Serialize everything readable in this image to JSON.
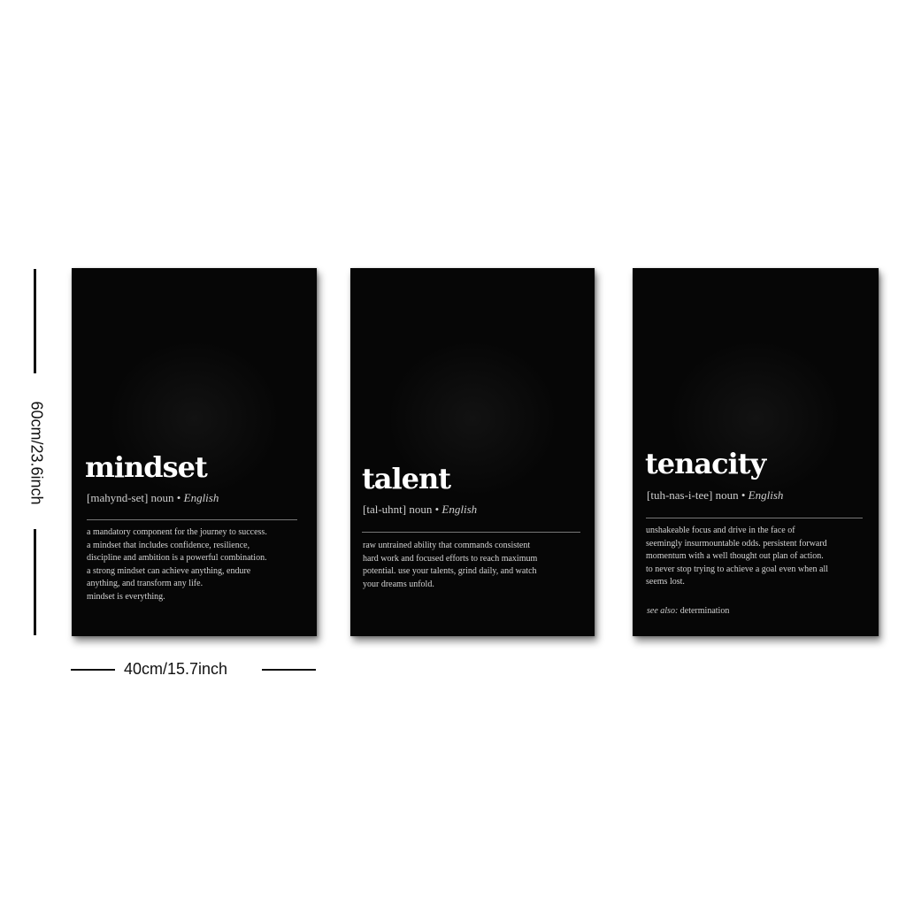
{
  "dimensions": {
    "height_label": "60cm/23.6inch",
    "width_label": "40cm/15.7inch"
  },
  "panels": [
    {
      "word": "mindset",
      "pronunciation": "[mahynd-set] noun •",
      "language": "English",
      "definition_lines": [
        "a mandatory component for the journey to success.",
        "a mindset that includes confidence, resilience,",
        "discipline and ambition is a powerful combination.",
        "a strong mindset can achieve anything, endure",
        "anything, and transform any life.",
        "mindset is everything."
      ]
    },
    {
      "word": "talent",
      "pronunciation": "[tal-uhnt] noun •",
      "language": "English",
      "definition_lines": [
        "raw untrained ability that commands consistent",
        "hard work and focused efforts to reach maximum",
        "potential. use your talents, grind daily, and watch",
        "your dreams unfold."
      ]
    },
    {
      "word": "tenacity",
      "pronunciation": "[tuh-nas-i-tee] noun •",
      "language": "English",
      "definition_lines": [
        "unshakeable focus and drive in the face of",
        "seemingly insurmountable odds. persistent forward",
        "momentum with a well thought out plan of action.",
        "to never stop trying to achieve a goal even when all",
        "seems lost."
      ],
      "see_also_label": "see also:",
      "see_also_value": "determination"
    }
  ]
}
